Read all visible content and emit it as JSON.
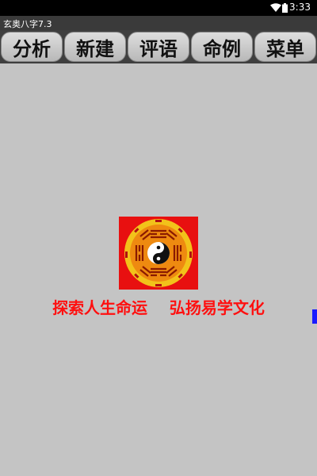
{
  "status_bar": {
    "time": "3:33",
    "wifi_icon": "wifi-icon",
    "battery_icon": "battery-icon"
  },
  "app": {
    "title": "玄奥八字7.3"
  },
  "toolbar": {
    "buttons": [
      {
        "label": "分析"
      },
      {
        "label": "新建"
      },
      {
        "label": "评语"
      },
      {
        "label": "命例"
      },
      {
        "label": "菜单"
      }
    ]
  },
  "main": {
    "logo_icon": "bagua-taiji-icon",
    "slogan": "探索人生命运    弘扬易学文化"
  },
  "colors": {
    "background": "#c4c4c4",
    "slogan": "#ff1010",
    "logo_bg": "#e81010"
  }
}
